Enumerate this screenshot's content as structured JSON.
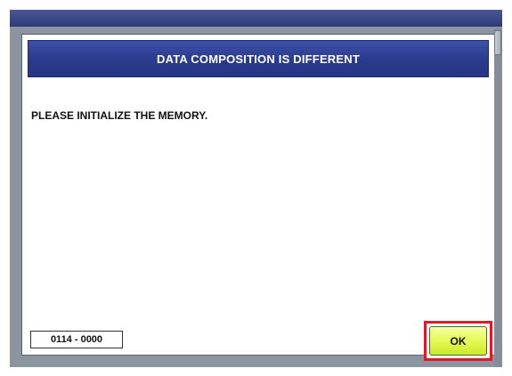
{
  "dialog": {
    "title": "DATA COMPOSITION IS DIFFERENT",
    "message": "PLEASE INITIALIZE THE MEMORY.",
    "error_code": "0114 - 0000",
    "ok_label": "OK"
  },
  "colors": {
    "title_bar": "#2a3a8c",
    "ok_button": "#e6fb5a",
    "highlight": "#e3172a",
    "screen_bg": "#8c959f"
  }
}
